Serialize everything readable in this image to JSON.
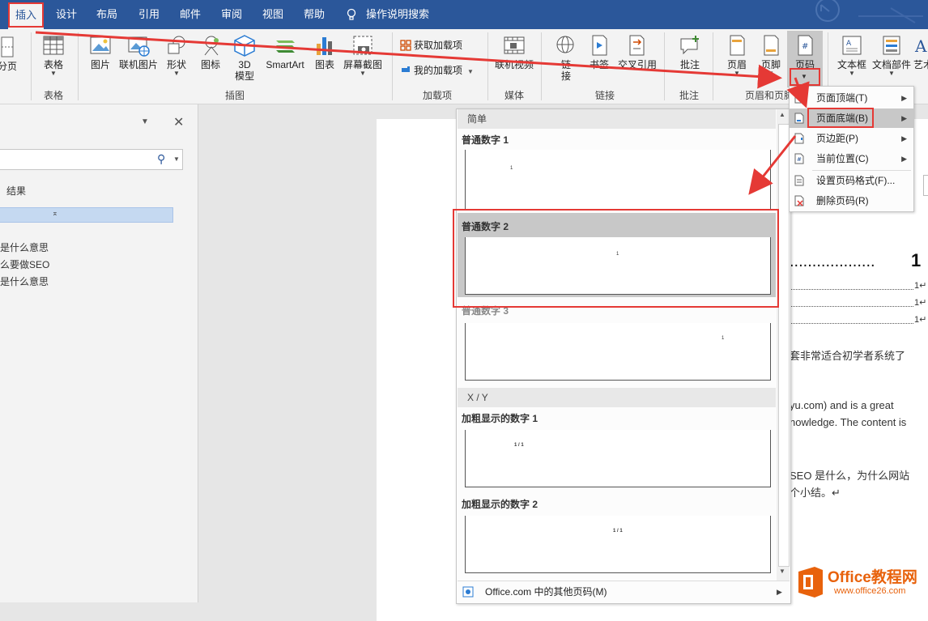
{
  "tabs": [
    "插入",
    "设计",
    "布局",
    "引用",
    "邮件",
    "审阅",
    "视图",
    "帮助"
  ],
  "tell_me": "操作说明搜索",
  "ribbon": {
    "partial_left": "分页",
    "table": "表格",
    "picture": "图片",
    "online_picture": "联机图片",
    "shapes": "形状",
    "icons": "图标",
    "model_3d": "3D\n模型",
    "smartart": "SmartArt",
    "chart": "图表",
    "screenshot": "屏幕截图",
    "get_addins": "获取加载项",
    "my_addins": "我的加载项",
    "online_video": "联机视频",
    "link": "链\n接",
    "bookmark": "书签",
    "cross_ref": "交叉引用",
    "comment": "批注",
    "header": "页眉",
    "footer": "页脚",
    "page_number": "页码",
    "textbox": "文本框",
    "quick_parts": "文档部件",
    "wordart": "艺术",
    "groups": {
      "table": "表格",
      "illustrations": "插图",
      "addins": "加载项",
      "media": "媒体",
      "links": "链接",
      "comments": "批注",
      "header_footer": "页眉和页脚"
    }
  },
  "nav": {
    "results": "结果",
    "items": [
      "是什么意思",
      "么要做SEO",
      "是什么意思"
    ],
    "search_placeholder": ""
  },
  "gallery": {
    "section_simple": "简单",
    "section_xy": "X / Y",
    "plain1": "普通数字 1",
    "plain2": "普通数字 2",
    "plain3": "普通数字 3",
    "bold1": "加粗显示的数字 1",
    "bold2": "加粗显示的数字 2",
    "num": "1",
    "xy": "1 / 1",
    "footer": "Office.com 中的其他页码(M)"
  },
  "submenu": {
    "items": [
      "页面顶端(T)",
      "页面底端(B)",
      "页边距(P)",
      "当前位置(C)",
      "设置页码格式(F)...",
      "删除页码(R)"
    ]
  },
  "doc": {
    "toc_big": "1",
    "toc_small": [
      "1↵",
      "1↵",
      "1↵"
    ],
    "lines": [
      "套非常适合初学者系统了",
      "yu.com) and is a great",
      "nowledge. The content is",
      "SEO 是什么，为什么网站",
      "个小结。↵"
    ]
  },
  "watermark": {
    "brand": "Office教程网",
    "url": "www.office26.com"
  },
  "colors": {
    "ribbon_blue": "#2b579a",
    "highlight_red": "#e53935",
    "selected_gray": "#c8c8c8"
  }
}
